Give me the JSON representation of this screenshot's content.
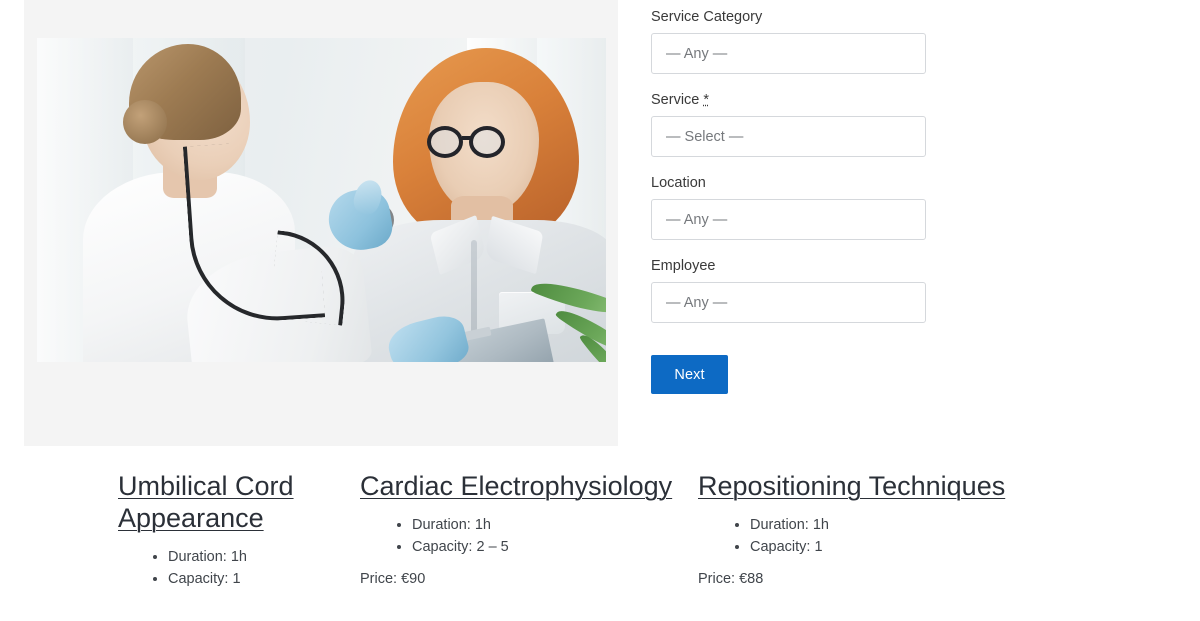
{
  "form": {
    "fields": [
      {
        "label": "Service Category",
        "required": false,
        "value": "— Any —",
        "name": "service-category"
      },
      {
        "label": "Service",
        "required": true,
        "required_mark": "*",
        "value": "— Select —",
        "name": "service"
      },
      {
        "label": "Location",
        "required": false,
        "value": "— Any —",
        "name": "location"
      },
      {
        "label": "Employee",
        "required": false,
        "value": "— Any —",
        "name": "employee"
      }
    ],
    "submit_label": "Next",
    "accent_color": "#0d6ac4"
  },
  "media": {
    "alt": "Doctor with stethoscope examining a patient holding a clipboard",
    "panel_background": "#f4f4f4"
  },
  "services": [
    {
      "title": "Umbilical Cord Appearance",
      "duration": "Duration: 1h",
      "capacity": "Capacity: 1",
      "price": ""
    },
    {
      "title": "Cardiac Electrophysiology",
      "duration": "Duration: 1h",
      "capacity": "Capacity: 2 – 5",
      "price": "Price: €90"
    },
    {
      "title": "Repositioning Techniques",
      "duration": "Duration: 1h",
      "capacity": "Capacity: 1",
      "price": "Price: €88"
    }
  ]
}
